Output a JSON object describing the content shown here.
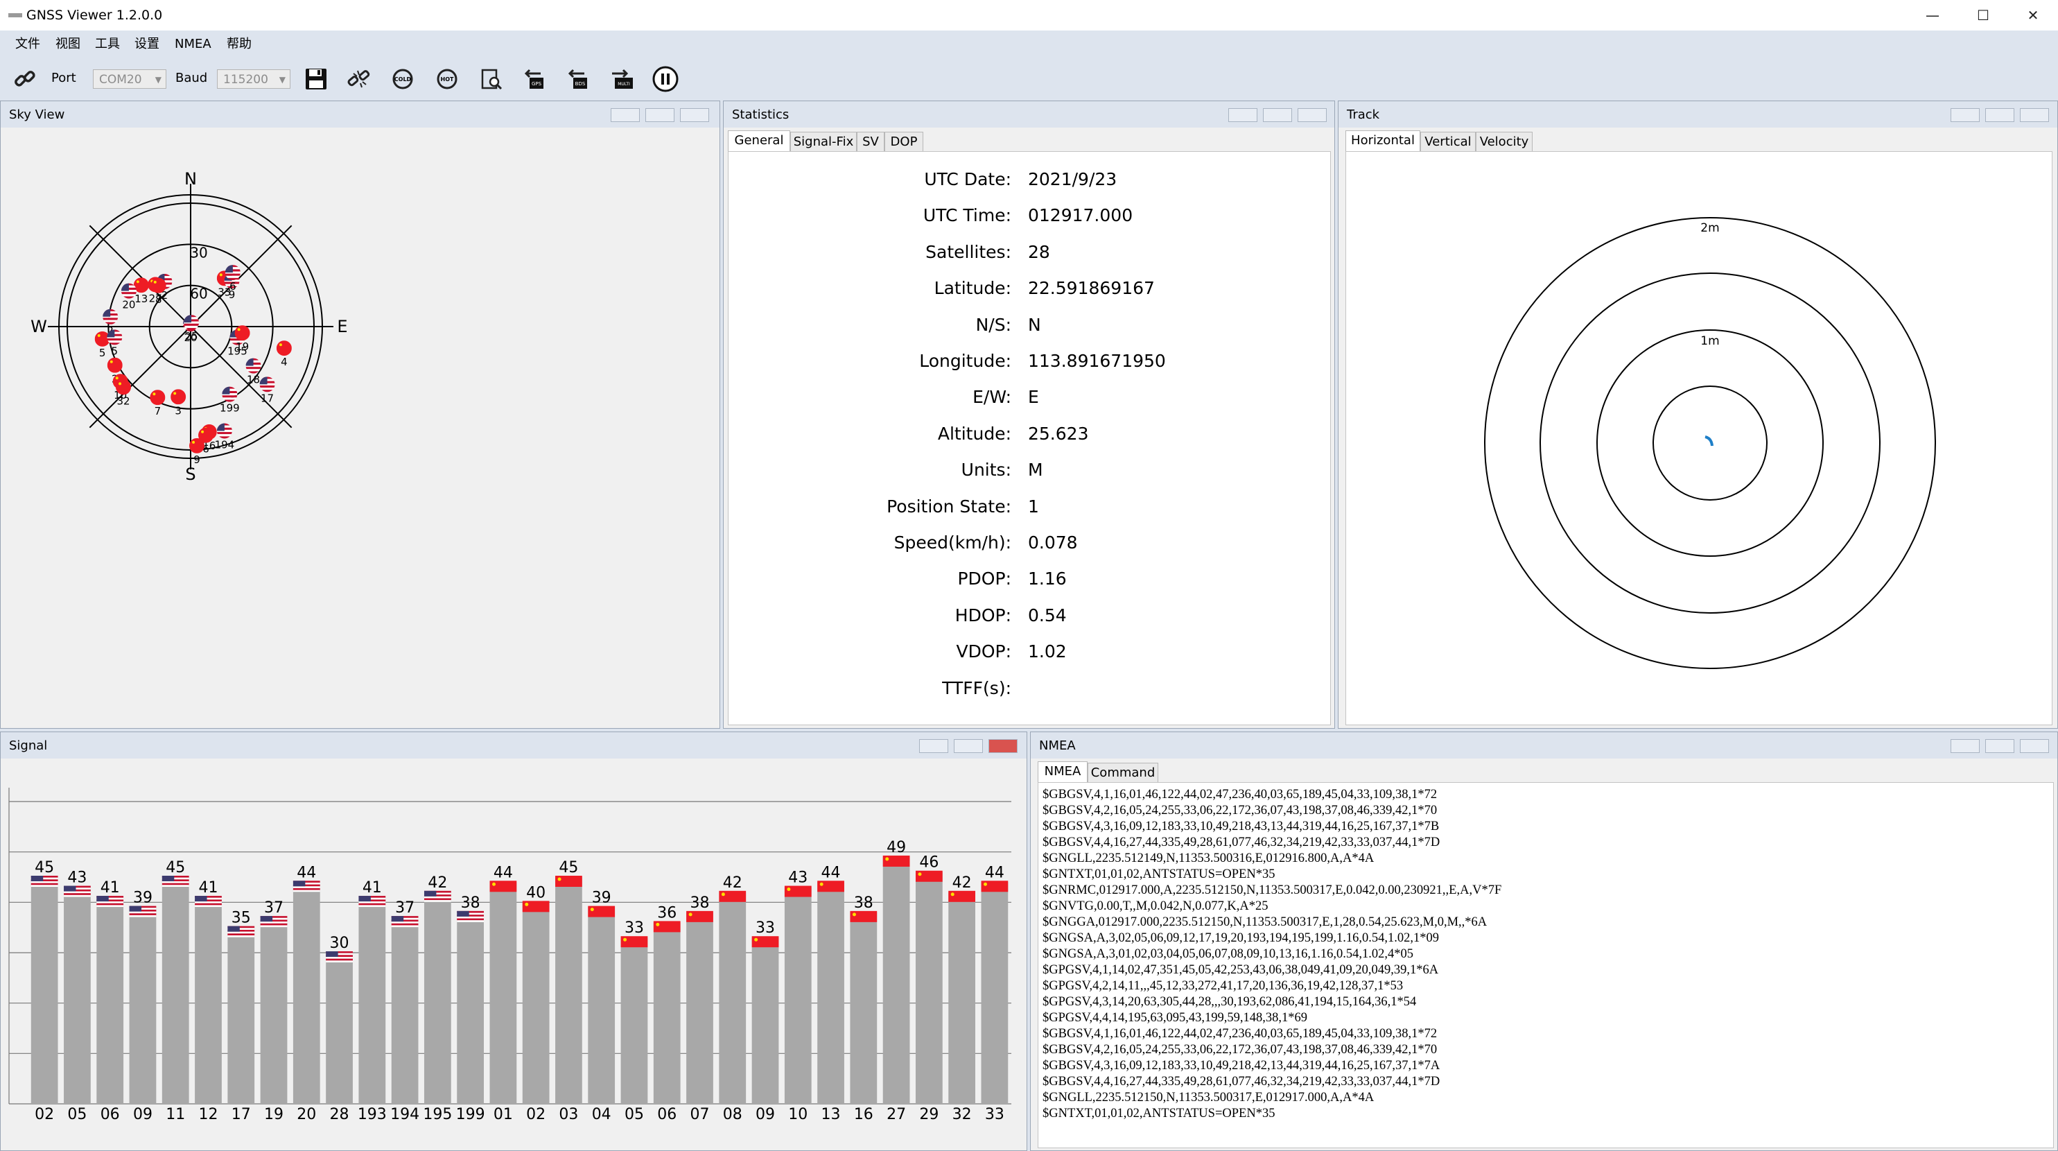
{
  "window": {
    "title": "GNSS Viewer  1.2.0.0",
    "minimize": "—",
    "maximize": "☐",
    "close": "✕"
  },
  "menu": [
    "文件",
    "视图",
    "工具",
    "设置",
    "NMEA",
    "帮助"
  ],
  "toolbar": {
    "port_label": "Port",
    "port_value": "COM20",
    "baud_label": "Baud",
    "baud_value": "115200"
  },
  "sky_view": {
    "title": "Sky View",
    "directions": {
      "n": "N",
      "s": "S",
      "e": "E",
      "w": "W"
    },
    "ring_labels": [
      "30",
      "60"
    ],
    "satellites": [
      {
        "id": "20",
        "flag": "us",
        "el": 88,
        "az": 0
      },
      {
        "id": "25",
        "flag": "us",
        "el": 87,
        "az": 10
      },
      {
        "id": "2",
        "flag": "us",
        "el": 52,
        "az": 330
      },
      {
        "id": "27",
        "flag": "cn",
        "el": 50,
        "az": 320
      },
      {
        "id": "8",
        "flag": "cn",
        "el": 52,
        "az": 322
      },
      {
        "id": "13",
        "flag": "cn",
        "el": 43,
        "az": 310
      },
      {
        "id": "20",
        "flag": "us",
        "el": 38,
        "az": 300
      },
      {
        "id": "33",
        "flag": "cn",
        "el": 47,
        "az": 35
      },
      {
        "id": "9",
        "flag": "us",
        "el": 45,
        "az": 42
      },
      {
        "id": "6",
        "flag": "us",
        "el": 40,
        "az": 38
      },
      {
        "id": "2",
        "flag": "us",
        "el": 31,
        "az": 277
      },
      {
        "id": "5",
        "flag": "cn",
        "el": 25,
        "az": 262
      },
      {
        "id": "5",
        "flag": "us",
        "el": 34,
        "az": 262
      },
      {
        "id": "2",
        "flag": "cn",
        "el": 28,
        "az": 243
      },
      {
        "id": "10",
        "flag": "cn",
        "el": 25,
        "az": 232
      },
      {
        "id": "32",
        "flag": "cn",
        "el": 24,
        "az": 228
      },
      {
        "id": "7",
        "flag": "cn",
        "el": 33,
        "az": 205
      },
      {
        "id": "3",
        "flag": "cn",
        "el": 38,
        "az": 190
      },
      {
        "id": "199",
        "flag": "us",
        "el": 33,
        "az": 150
      },
      {
        "id": "16",
        "flag": "cn",
        "el": 12,
        "az": 170
      },
      {
        "id": "6",
        "flag": "cn",
        "el": 10,
        "az": 172
      },
      {
        "id": "194",
        "flag": "us",
        "el": 10,
        "az": 162
      },
      {
        "id": "9",
        "flag": "cn",
        "el": 3,
        "az": 177
      },
      {
        "id": "195",
        "flag": "us",
        "el": 55,
        "az": 103
      },
      {
        "id": "19",
        "flag": "cn",
        "el": 52,
        "az": 97
      },
      {
        "id": "4",
        "flag": "cn",
        "el": 20,
        "az": 103
      },
      {
        "id": "18",
        "flag": "us",
        "el": 36,
        "az": 122
      },
      {
        "id": "17",
        "flag": "us",
        "el": 20,
        "az": 127
      }
    ]
  },
  "statistics": {
    "title": "Statistics",
    "tabs": [
      "General",
      "Signal-Fix",
      "SV",
      "DOP"
    ],
    "rows": [
      {
        "label": "UTC Date:",
        "value": "2021/9/23"
      },
      {
        "label": "UTC Time:",
        "value": "012917.000"
      },
      {
        "label": "Satellites:",
        "value": "28"
      },
      {
        "label": "Latitude:",
        "value": "22.591869167"
      },
      {
        "label": "N/S:",
        "value": "N"
      },
      {
        "label": "Longitude:",
        "value": "113.891671950"
      },
      {
        "label": "E/W:",
        "value": "E"
      },
      {
        "label": "Altitude:",
        "value": "25.623"
      },
      {
        "label": "Units:",
        "value": "M"
      },
      {
        "label": "Position State:",
        "value": "1"
      },
      {
        "label": "Speed(km/h):",
        "value": "0.078"
      },
      {
        "label": "PDOP:",
        "value": "1.16"
      },
      {
        "label": "HDOP:",
        "value": "0.54"
      },
      {
        "label": "VDOP:",
        "value": "1.02"
      },
      {
        "label": "TTFF(s):",
        "value": ""
      }
    ]
  },
  "track": {
    "title": "Track",
    "tabs": [
      "Horizontal",
      "Vertical",
      "Velocity"
    ],
    "ring_labels": [
      "2m",
      "1m"
    ]
  },
  "signal": {
    "title": "Signal",
    "bars": [
      {
        "id": "02",
        "snr": 45,
        "flag": "us"
      },
      {
        "id": "05",
        "snr": 43,
        "flag": "us"
      },
      {
        "id": "06",
        "snr": 41,
        "flag": "us"
      },
      {
        "id": "09",
        "snr": 39,
        "flag": "us"
      },
      {
        "id": "11",
        "snr": 45,
        "flag": "us"
      },
      {
        "id": "12",
        "snr": 41,
        "flag": "us"
      },
      {
        "id": "17",
        "snr": 35,
        "flag": "us"
      },
      {
        "id": "19",
        "snr": 37,
        "flag": "us"
      },
      {
        "id": "20",
        "snr": 44,
        "flag": "us"
      },
      {
        "id": "28",
        "snr": 30,
        "flag": "us"
      },
      {
        "id": "193",
        "snr": 41,
        "flag": "us"
      },
      {
        "id": "194",
        "snr": 37,
        "flag": "us"
      },
      {
        "id": "195",
        "snr": 42,
        "flag": "us"
      },
      {
        "id": "199",
        "snr": 38,
        "flag": "us"
      },
      {
        "id": "01",
        "snr": 44,
        "flag": "cn"
      },
      {
        "id": "02",
        "snr": 40,
        "flag": "cn"
      },
      {
        "id": "03",
        "snr": 45,
        "flag": "cn"
      },
      {
        "id": "04",
        "snr": 39,
        "flag": "cn"
      },
      {
        "id": "05",
        "snr": 33,
        "flag": "cn"
      },
      {
        "id": "06",
        "snr": 36,
        "flag": "cn"
      },
      {
        "id": "07",
        "snr": 38,
        "flag": "cn"
      },
      {
        "id": "08",
        "snr": 42,
        "flag": "cn"
      },
      {
        "id": "09",
        "snr": 33,
        "flag": "cn"
      },
      {
        "id": "10",
        "snr": 43,
        "flag": "cn"
      },
      {
        "id": "13",
        "snr": 44,
        "flag": "cn"
      },
      {
        "id": "16",
        "snr": 38,
        "flag": "cn"
      },
      {
        "id": "27",
        "snr": 49,
        "flag": "cn"
      },
      {
        "id": "29",
        "snr": 46,
        "flag": "cn"
      },
      {
        "id": "32",
        "snr": 42,
        "flag": "cn"
      },
      {
        "id": "33",
        "snr": 44,
        "flag": "cn"
      }
    ]
  },
  "nmea": {
    "title": "NMEA",
    "tabs": [
      "NMEA",
      "Command"
    ],
    "lines": [
      "$GBGSV,4,1,16,01,46,122,44,02,47,236,40,03,65,189,45,04,33,109,38,1*72",
      "$GBGSV,4,2,16,05,24,255,33,06,22,172,36,07,43,198,37,08,46,339,42,1*70",
      "$GBGSV,4,3,16,09,12,183,33,10,49,218,43,13,44,319,44,16,25,167,37,1*7B",
      "$GBGSV,4,4,16,27,44,335,49,28,61,077,46,32,34,219,42,33,33,037,44,1*7D",
      "$GNGLL,2235.512149,N,11353.500316,E,012916.800,A,A*4A",
      "$GNTXT,01,01,02,ANTSTATUS=OPEN*35",
      "$GNRMC,012917.000,A,2235.512150,N,11353.500317,E,0.042,0.00,230921,,E,A,V*7F",
      "$GNVTG,0.00,T,,M,0.042,N,0.077,K,A*25",
      "$GNGGA,012917.000,2235.512150,N,11353.500317,E,1,28,0.54,25.623,M,0,M,,*6A",
      "$GNGSA,A,3,02,05,06,09,12,17,19,20,193,194,195,199,1.16,0.54,1.02,1*09",
      "$GNGSA,A,3,01,02,03,04,05,06,07,08,09,10,13,16,1.16,0.54,1.02,4*05",
      "$GPGSV,4,1,14,02,47,351,45,05,42,253,43,06,38,049,41,09,20,049,39,1*6A",
      "$GPGSV,4,2,14,11,,,45,12,33,272,41,17,20,136,36,19,42,128,37,1*53",
      "$GPGSV,4,3,14,20,63,305,44,28,,,30,193,62,086,41,194,15,164,36,1*54",
      "$GPGSV,4,4,14,195,63,095,43,199,59,148,38,1*69",
      "$GBGSV,4,1,16,01,46,122,44,02,47,236,40,03,65,189,45,04,33,109,38,1*72",
      "$GBGSV,4,2,16,05,24,255,33,06,22,172,36,07,43,198,37,08,46,339,42,1*70",
      "$GBGSV,4,3,16,09,12,183,33,10,49,218,42,13,44,319,44,16,25,167,37,1*7A",
      "$GBGSV,4,4,16,27,44,335,49,28,61,077,46,32,34,219,42,33,33,037,44,1*7D",
      "$GNGLL,2235.512150,N,11353.500317,E,012917.000,A,A*4A",
      "$GNTXT,01,01,02,ANTSTATUS=OPEN*35"
    ]
  },
  "colors": {
    "bar": "#a8a8a8",
    "us_red": "#c8102e",
    "us_blue": "#3c3b6e",
    "cn_red": "#ee1c25",
    "cn_star": "#ffde00",
    "track_dot": "#1e7fc8"
  }
}
